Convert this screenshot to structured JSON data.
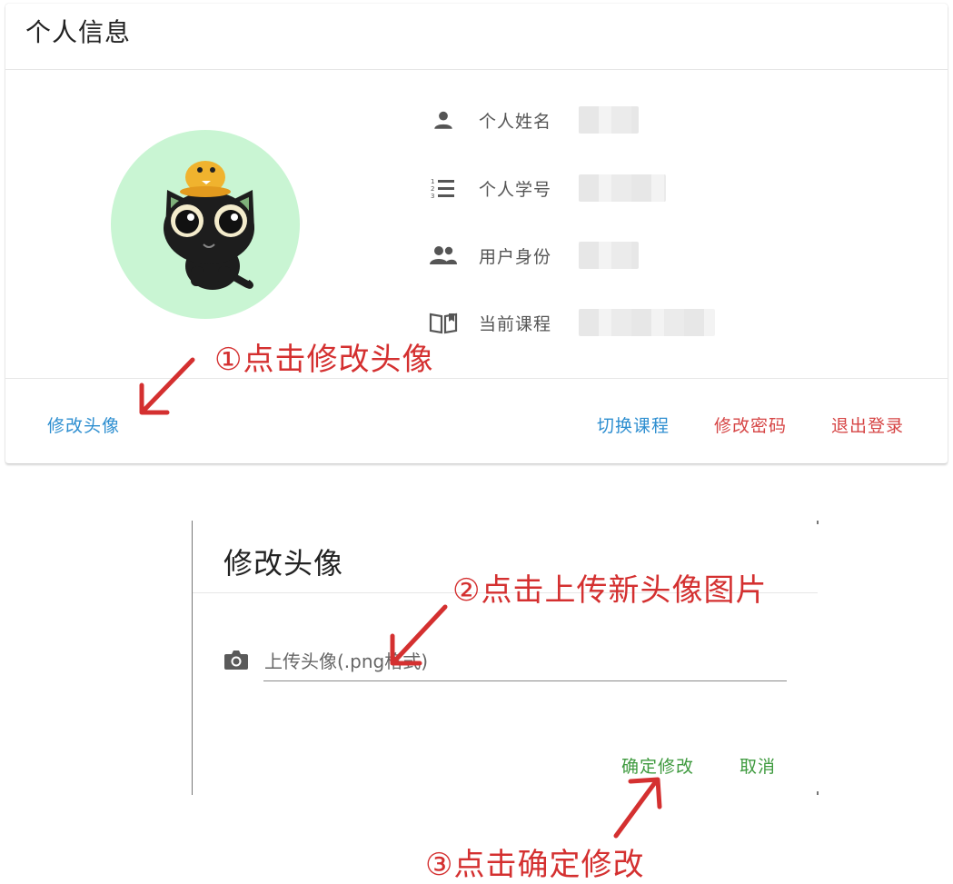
{
  "profile_card": {
    "title": "个人信息",
    "rows": [
      {
        "icon": "person-icon",
        "label": "个人姓名"
      },
      {
        "icon": "numbered-list-icon",
        "label": "个人学号"
      },
      {
        "icon": "people-icon",
        "label": "用户身份"
      },
      {
        "icon": "book-icon",
        "label": "当前课程"
      }
    ],
    "actions": {
      "change_avatar": "修改头像",
      "switch_course": "切换课程",
      "change_password": "修改密码",
      "logout": "退出登录"
    }
  },
  "dialog": {
    "title": "修改头像",
    "upload_label": "上传头像(.png格式)",
    "confirm": "确定修改",
    "cancel": "取消"
  },
  "annotations": {
    "step1": "①点击修改头像",
    "step2": "②点击上传新头像图片",
    "step3": "③点击确定修改"
  },
  "colors": {
    "link_blue": "#2d8ed0",
    "danger_red": "#d64545",
    "confirm_green": "#3e9a3e",
    "annotation_red": "#d43030",
    "avatar_bg": "#c9f5d3"
  }
}
